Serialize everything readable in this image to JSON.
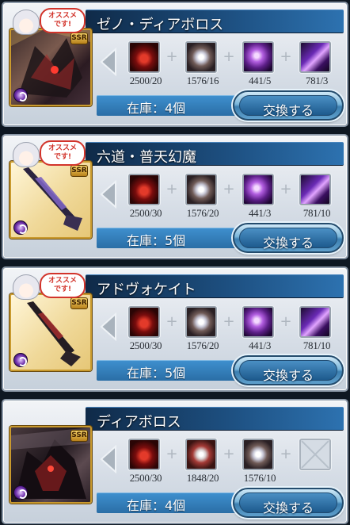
{
  "recommend_badge": {
    "text": "オススメ\nです!"
  },
  "cards": [
    {
      "title": "ゼノ・ディアボロス",
      "rarity": "SSR",
      "element": "dark",
      "thumbnail": "summon-art",
      "recommended": true,
      "items": [
        {
          "icon": "red-crystal-icon",
          "count": "2500/20"
        },
        {
          "icon": "silver-orb-icon",
          "count": "1576/16"
        },
        {
          "icon": "purple-orb-icon",
          "count": "441/5"
        },
        {
          "icon": "purple-wing-icon",
          "count": "781/3"
        }
      ],
      "stock": "在庫：4個",
      "exchange_label": "交換する"
    },
    {
      "title": "六道・普天幻魔",
      "rarity": "SSR",
      "element": "dark",
      "thumbnail": "weapon-art",
      "recommended": true,
      "items": [
        {
          "icon": "red-crystal-icon",
          "count": "2500/30"
        },
        {
          "icon": "silver-orb-icon",
          "count": "1576/20"
        },
        {
          "icon": "purple-orb-icon",
          "count": "441/3"
        },
        {
          "icon": "purple-wing-icon",
          "count": "781/10"
        }
      ],
      "stock": "在庫：5個",
      "exchange_label": "交換する"
    },
    {
      "title": "アドヴォケイト",
      "rarity": "SSR",
      "element": "dark",
      "thumbnail": "weapon-art",
      "recommended": true,
      "items": [
        {
          "icon": "red-crystal-icon",
          "count": "2500/30"
        },
        {
          "icon": "silver-orb-icon",
          "count": "1576/20"
        },
        {
          "icon": "purple-orb-icon",
          "count": "441/3"
        },
        {
          "icon": "purple-wing-icon",
          "count": "781/10"
        }
      ],
      "stock": "在庫：5個",
      "exchange_label": "交換する"
    },
    {
      "title": "ディアボロス",
      "rarity": "SSR",
      "element": "dark",
      "thumbnail": "summon-art",
      "recommended": false,
      "items": [
        {
          "icon": "red-crystal-icon",
          "count": "2500/30"
        },
        {
          "icon": "red-silver-orb-icon",
          "count": "1848/20"
        },
        {
          "icon": "silver-orb-icon",
          "count": "1576/10"
        },
        {
          "icon": "empty-slot-icon",
          "count": ""
        }
      ],
      "stock": "在庫：4個",
      "exchange_label": "交換する"
    }
  ]
}
